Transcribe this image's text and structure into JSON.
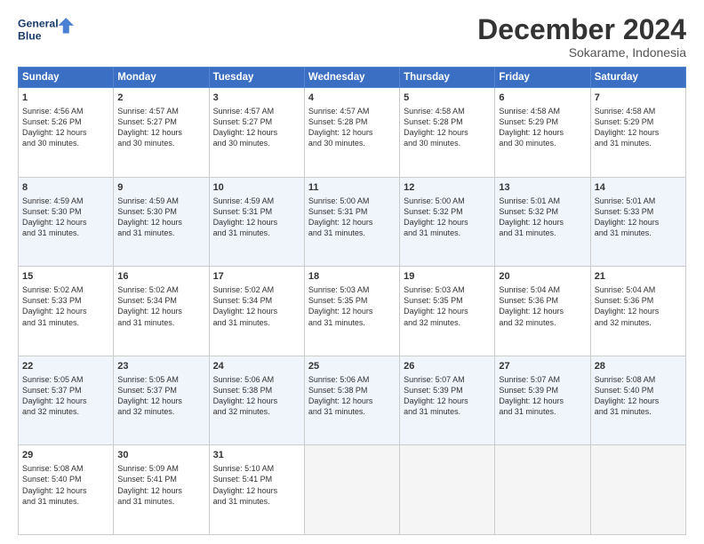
{
  "logo": {
    "line1": "General",
    "line2": "Blue"
  },
  "title": "December 2024",
  "subtitle": "Sokarame, Indonesia",
  "headers": [
    "Sunday",
    "Monday",
    "Tuesday",
    "Wednesday",
    "Thursday",
    "Friday",
    "Saturday"
  ],
  "weeks": [
    [
      {
        "day": "1",
        "lines": [
          "Sunrise: 4:56 AM",
          "Sunset: 5:26 PM",
          "Daylight: 12 hours",
          "and 30 minutes."
        ]
      },
      {
        "day": "2",
        "lines": [
          "Sunrise: 4:57 AM",
          "Sunset: 5:27 PM",
          "Daylight: 12 hours",
          "and 30 minutes."
        ]
      },
      {
        "day": "3",
        "lines": [
          "Sunrise: 4:57 AM",
          "Sunset: 5:27 PM",
          "Daylight: 12 hours",
          "and 30 minutes."
        ]
      },
      {
        "day": "4",
        "lines": [
          "Sunrise: 4:57 AM",
          "Sunset: 5:28 PM",
          "Daylight: 12 hours",
          "and 30 minutes."
        ]
      },
      {
        "day": "5",
        "lines": [
          "Sunrise: 4:58 AM",
          "Sunset: 5:28 PM",
          "Daylight: 12 hours",
          "and 30 minutes."
        ]
      },
      {
        "day": "6",
        "lines": [
          "Sunrise: 4:58 AM",
          "Sunset: 5:29 PM",
          "Daylight: 12 hours",
          "and 30 minutes."
        ]
      },
      {
        "day": "7",
        "lines": [
          "Sunrise: 4:58 AM",
          "Sunset: 5:29 PM",
          "Daylight: 12 hours",
          "and 31 minutes."
        ]
      }
    ],
    [
      {
        "day": "8",
        "lines": [
          "Sunrise: 4:59 AM",
          "Sunset: 5:30 PM",
          "Daylight: 12 hours",
          "and 31 minutes."
        ]
      },
      {
        "day": "9",
        "lines": [
          "Sunrise: 4:59 AM",
          "Sunset: 5:30 PM",
          "Daylight: 12 hours",
          "and 31 minutes."
        ]
      },
      {
        "day": "10",
        "lines": [
          "Sunrise: 4:59 AM",
          "Sunset: 5:31 PM",
          "Daylight: 12 hours",
          "and 31 minutes."
        ]
      },
      {
        "day": "11",
        "lines": [
          "Sunrise: 5:00 AM",
          "Sunset: 5:31 PM",
          "Daylight: 12 hours",
          "and 31 minutes."
        ]
      },
      {
        "day": "12",
        "lines": [
          "Sunrise: 5:00 AM",
          "Sunset: 5:32 PM",
          "Daylight: 12 hours",
          "and 31 minutes."
        ]
      },
      {
        "day": "13",
        "lines": [
          "Sunrise: 5:01 AM",
          "Sunset: 5:32 PM",
          "Daylight: 12 hours",
          "and 31 minutes."
        ]
      },
      {
        "day": "14",
        "lines": [
          "Sunrise: 5:01 AM",
          "Sunset: 5:33 PM",
          "Daylight: 12 hours",
          "and 31 minutes."
        ]
      }
    ],
    [
      {
        "day": "15",
        "lines": [
          "Sunrise: 5:02 AM",
          "Sunset: 5:33 PM",
          "Daylight: 12 hours",
          "and 31 minutes."
        ]
      },
      {
        "day": "16",
        "lines": [
          "Sunrise: 5:02 AM",
          "Sunset: 5:34 PM",
          "Daylight: 12 hours",
          "and 31 minutes."
        ]
      },
      {
        "day": "17",
        "lines": [
          "Sunrise: 5:02 AM",
          "Sunset: 5:34 PM",
          "Daylight: 12 hours",
          "and 31 minutes."
        ]
      },
      {
        "day": "18",
        "lines": [
          "Sunrise: 5:03 AM",
          "Sunset: 5:35 PM",
          "Daylight: 12 hours",
          "and 31 minutes."
        ]
      },
      {
        "day": "19",
        "lines": [
          "Sunrise: 5:03 AM",
          "Sunset: 5:35 PM",
          "Daylight: 12 hours",
          "and 32 minutes."
        ]
      },
      {
        "day": "20",
        "lines": [
          "Sunrise: 5:04 AM",
          "Sunset: 5:36 PM",
          "Daylight: 12 hours",
          "and 32 minutes."
        ]
      },
      {
        "day": "21",
        "lines": [
          "Sunrise: 5:04 AM",
          "Sunset: 5:36 PM",
          "Daylight: 12 hours",
          "and 32 minutes."
        ]
      }
    ],
    [
      {
        "day": "22",
        "lines": [
          "Sunrise: 5:05 AM",
          "Sunset: 5:37 PM",
          "Daylight: 12 hours",
          "and 32 minutes."
        ]
      },
      {
        "day": "23",
        "lines": [
          "Sunrise: 5:05 AM",
          "Sunset: 5:37 PM",
          "Daylight: 12 hours",
          "and 32 minutes."
        ]
      },
      {
        "day": "24",
        "lines": [
          "Sunrise: 5:06 AM",
          "Sunset: 5:38 PM",
          "Daylight: 12 hours",
          "and 32 minutes."
        ]
      },
      {
        "day": "25",
        "lines": [
          "Sunrise: 5:06 AM",
          "Sunset: 5:38 PM",
          "Daylight: 12 hours",
          "and 31 minutes."
        ]
      },
      {
        "day": "26",
        "lines": [
          "Sunrise: 5:07 AM",
          "Sunset: 5:39 PM",
          "Daylight: 12 hours",
          "and 31 minutes."
        ]
      },
      {
        "day": "27",
        "lines": [
          "Sunrise: 5:07 AM",
          "Sunset: 5:39 PM",
          "Daylight: 12 hours",
          "and 31 minutes."
        ]
      },
      {
        "day": "28",
        "lines": [
          "Sunrise: 5:08 AM",
          "Sunset: 5:40 PM",
          "Daylight: 12 hours",
          "and 31 minutes."
        ]
      }
    ],
    [
      {
        "day": "29",
        "lines": [
          "Sunrise: 5:08 AM",
          "Sunset: 5:40 PM",
          "Daylight: 12 hours",
          "and 31 minutes."
        ]
      },
      {
        "day": "30",
        "lines": [
          "Sunrise: 5:09 AM",
          "Sunset: 5:41 PM",
          "Daylight: 12 hours",
          "and 31 minutes."
        ]
      },
      {
        "day": "31",
        "lines": [
          "Sunrise: 5:10 AM",
          "Sunset: 5:41 PM",
          "Daylight: 12 hours",
          "and 31 minutes."
        ]
      },
      null,
      null,
      null,
      null
    ]
  ]
}
